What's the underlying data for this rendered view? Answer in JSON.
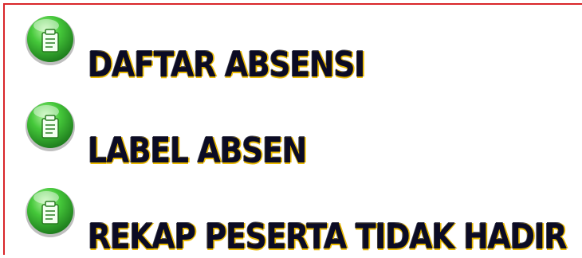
{
  "menu": {
    "items": [
      {
        "label": "DAFTAR ABSENSI",
        "icon": "green-document-icon"
      },
      {
        "label": "LABEL ABSEN",
        "icon": "green-document-icon"
      },
      {
        "label": "REKAP PESERTA TIDAK HADIR",
        "icon": "green-document-icon"
      }
    ]
  },
  "colors": {
    "border": "#d9262a",
    "icon_green": "#39b54a",
    "text": "#0b0b24",
    "text_outline": "#e9b800"
  }
}
